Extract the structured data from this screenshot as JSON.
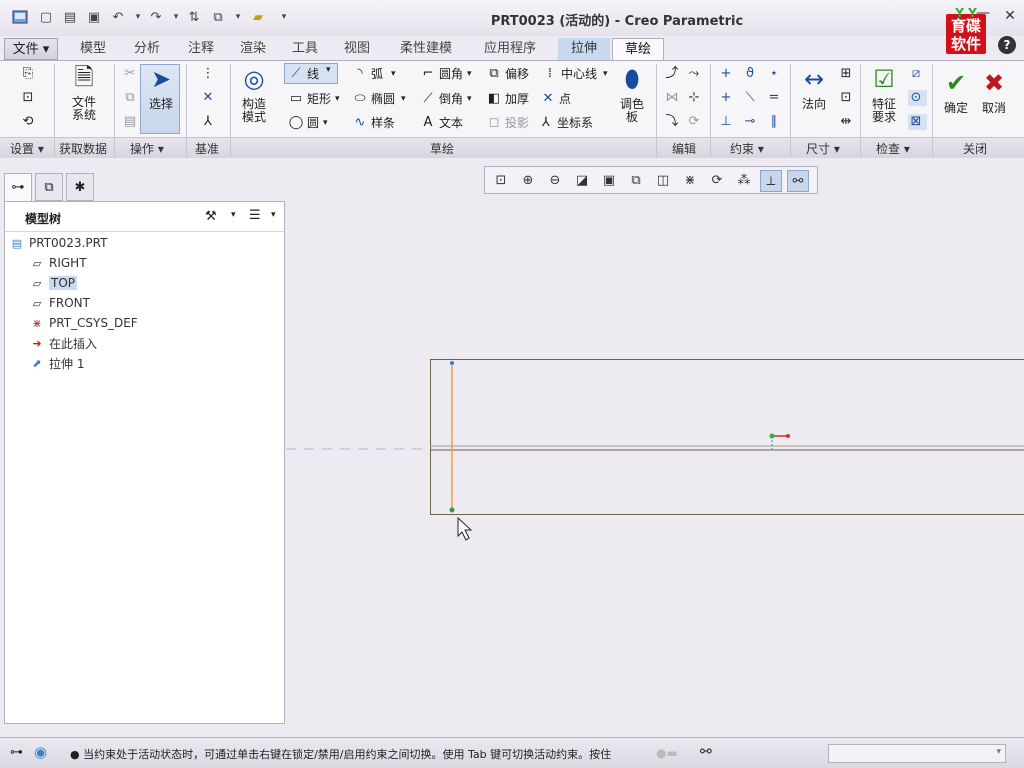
{
  "window": {
    "title": "PRT0023 (活动的) - Creo Parametric",
    "minimize": "—",
    "close": "✕",
    "help": "?"
  },
  "logo": {
    "top": "Y Y",
    "text": "育碟\n软件"
  },
  "quick_access": [
    "new-icon",
    "open-icon",
    "save-icon",
    "undo-icon",
    "redo-icon",
    "regenerate-icon",
    "windows-icon",
    "close-window-icon",
    "customize-icon"
  ],
  "tabs": [
    {
      "label": "文件 ▾"
    },
    {
      "label": "模型"
    },
    {
      "label": "分析"
    },
    {
      "label": "注释"
    },
    {
      "label": "渲染"
    },
    {
      "label": "工具"
    },
    {
      "label": "视图"
    },
    {
      "label": "柔性建模"
    },
    {
      "label": "应用程序"
    },
    {
      "label": "拉伸"
    },
    {
      "label": "草绘"
    }
  ],
  "ribbon": {
    "file_system": "文件\n系统",
    "select": "选择",
    "construct_mode": "构造\n模式",
    "line": "线",
    "arc": "弧",
    "fillet": "圆角",
    "offset": "偏移",
    "centerline": "中心线",
    "rectangle": "矩形",
    "ellipse": "椭圆",
    "chamfer": "倒角",
    "thicken": "加厚",
    "point": "点",
    "circle": "圆",
    "spline": "样条",
    "text": "文本",
    "project": "投影",
    "coord_sys": "坐标系",
    "palette": "调色\n板",
    "normal": "法向",
    "feature_req": "特征\n要求",
    "ok": "确定",
    "cancel": "取消"
  },
  "groups": {
    "setup": "设置 ▾",
    "get_data": "获取数据",
    "operations": "操作 ▾",
    "datum": "基准",
    "sketching": "草绘",
    "editing": "编辑",
    "constrain": "约束 ▾",
    "dimension": "尺寸 ▾",
    "inspect": "检查 ▾",
    "close": "关闭"
  },
  "model_tree": {
    "title": "模型树",
    "items": [
      {
        "label": "PRT0023.PRT",
        "icon": "part-icon"
      },
      {
        "label": "RIGHT",
        "icon": "datum-plane-icon"
      },
      {
        "label": "TOP",
        "icon": "datum-plane-icon"
      },
      {
        "label": "FRONT",
        "icon": "datum-plane-icon"
      },
      {
        "label": "PRT_CSYS_DEF",
        "icon": "csys-icon"
      },
      {
        "label": "在此插入",
        "icon": "insert-here-icon"
      },
      {
        "label": "拉伸 1",
        "icon": "extrude-icon"
      }
    ]
  },
  "status": {
    "message": "● 当约束处于活动状态时，可通过单击右键在锁定/禁用/启用约束之间切换。使用 Tab 键可切换活动约束。按住"
  },
  "colors": {
    "ribbon_bg": "#f6f5f8",
    "canvas_bg": "#eeeaf2",
    "sketch_line": "#f0a040",
    "rect_border": "#6b6342",
    "accent_blue": "#c6d9ee"
  }
}
